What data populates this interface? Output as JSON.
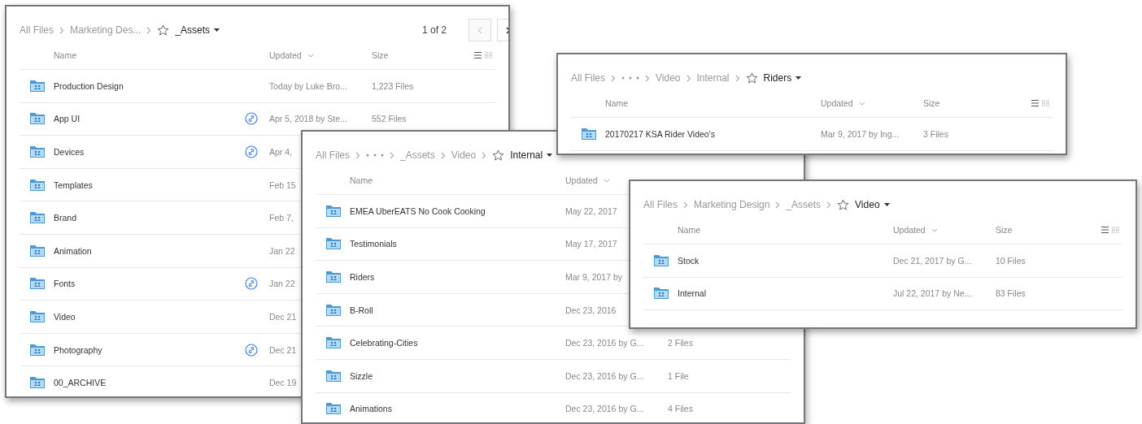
{
  "windows": [
    {
      "breadcrumb": [
        {
          "kind": "link",
          "label": "All Files"
        },
        {
          "kind": "link",
          "label": "Marketing Des..."
        }
      ],
      "current": "_Assets",
      "pagination": {
        "text": "1 of 2",
        "prev_disabled": true,
        "next_disabled": false
      },
      "columns": {
        "name": "Name",
        "updated": "Updated",
        "size": "Size"
      },
      "view_buttons": [
        {
          "kind": "list",
          "selected": true
        },
        {
          "kind": "grid",
          "selected": false
        }
      ],
      "rows": [
        {
          "name": "Production Design",
          "shared": false,
          "updated": "Today by Luke Bro...",
          "size": "1,223 Files"
        },
        {
          "name": "App UI",
          "shared": true,
          "updated": "Apr 5, 2018 by Ste...",
          "size": "552 Files"
        },
        {
          "name": "Devices",
          "shared": true,
          "updated": "Apr 4,"
        },
        {
          "name": "Templates",
          "shared": false,
          "updated": "Feb 15"
        },
        {
          "name": "Brand",
          "shared": false,
          "updated": "Feb 7,"
        },
        {
          "name": "Animation",
          "shared": false,
          "updated": "Jan 22"
        },
        {
          "name": "Fonts",
          "shared": true,
          "updated": "Jan 22"
        },
        {
          "name": "Video",
          "shared": false,
          "updated": "Dec 21"
        },
        {
          "name": "Photography",
          "shared": true,
          "updated": "Dec 21"
        },
        {
          "name": "00_ARCHIVE",
          "shared": false,
          "updated": "Dec 19"
        }
      ]
    },
    {
      "breadcrumb": [
        {
          "kind": "link",
          "label": "All Files"
        },
        {
          "kind": "ellipsis"
        },
        {
          "kind": "link",
          "label": "_Assets"
        },
        {
          "kind": "link",
          "label": "Video"
        }
      ],
      "current": "Internal",
      "columns": {
        "name": "Name",
        "updated": "Updated"
      },
      "rows": [
        {
          "name": "EMEA UberEATS No Cook Cooking",
          "updated": "May 22, 2017"
        },
        {
          "name": "Testimonials",
          "updated": "May 17, 2017"
        },
        {
          "name": "Riders",
          "updated": "Mar 9, 2017 by"
        },
        {
          "name": "B-Roll",
          "updated": "Dec 23, 2016"
        },
        {
          "name": "Celebrating-Cities",
          "updated": "Dec 23, 2016 by G...",
          "size": "2 Files"
        },
        {
          "name": "Sizzle",
          "updated": "Dec 23, 2016 by G...",
          "size": "1 File"
        },
        {
          "name": "Animations",
          "updated": "Dec 23, 2016 by G...",
          "size": "4 Files"
        }
      ]
    },
    {
      "breadcrumb": [
        {
          "kind": "link",
          "label": "All Files"
        },
        {
          "kind": "ellipsis"
        },
        {
          "kind": "link",
          "label": "Video"
        },
        {
          "kind": "link",
          "label": "Internal"
        }
      ],
      "current": "Riders",
      "columns": {
        "name": "Name",
        "updated": "Updated",
        "size": "Size"
      },
      "view_buttons": [
        {
          "kind": "list",
          "selected": true
        },
        {
          "kind": "grid",
          "selected": false
        }
      ],
      "rows": [
        {
          "name": "20170217 KSA Rider Video's",
          "updated": "Mar 9, 2017 by Ing...",
          "size": "3 Files"
        }
      ]
    },
    {
      "breadcrumb": [
        {
          "kind": "link",
          "label": "All Files"
        },
        {
          "kind": "link",
          "label": "Marketing Design"
        },
        {
          "kind": "link",
          "label": "_Assets"
        }
      ],
      "current": "Video",
      "columns": {
        "name": "Name",
        "updated": "Updated",
        "size": "Size"
      },
      "view_buttons": [
        {
          "kind": "list",
          "selected": true
        },
        {
          "kind": "grid",
          "selected": false
        }
      ],
      "rows": [
        {
          "name": "Stock",
          "updated": "Dec 21, 2017 by G...",
          "size": "10 Files"
        },
        {
          "name": "Internal",
          "updated": "Jul 22, 2017 by Ne...",
          "size": "83 Files"
        }
      ]
    }
  ]
}
